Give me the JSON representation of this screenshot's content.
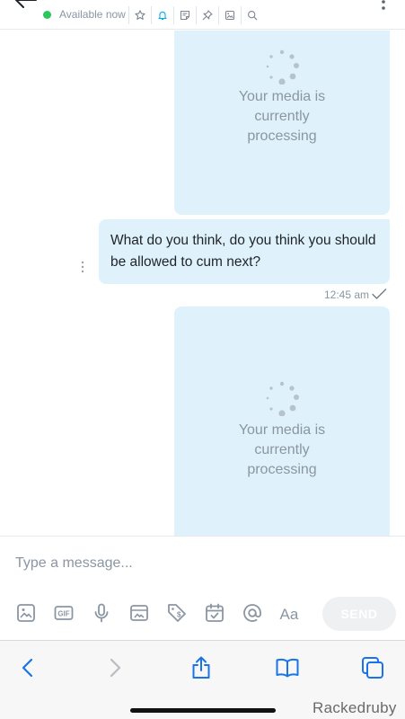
{
  "header": {
    "status": "Available now",
    "status_color": "#2bc65c",
    "icons": [
      "star-icon",
      "bell-icon",
      "note-icon",
      "pin-icon",
      "image-gallery-icon",
      "search-icon"
    ]
  },
  "messages": [
    {
      "type": "media",
      "text": "Your media is\ncurrently\nprocessing"
    },
    {
      "type": "text",
      "text": "What do you think, do you think you should be allowed to cum next?",
      "time": "12:45 am"
    },
    {
      "type": "media",
      "text": "Your media is\ncurrently\nprocessing"
    }
  ],
  "composer": {
    "placeholder": "Type a message...",
    "tools": [
      "image-icon",
      "gif-icon",
      "microphone-icon",
      "media-vault-icon",
      "price-tag-icon",
      "schedule-icon",
      "mention-icon",
      "text-format-icon"
    ],
    "send_label": "SEND"
  },
  "browser": {
    "buttons": [
      "back-icon",
      "forward-icon",
      "share-icon",
      "bookmarks-icon",
      "tabs-icon"
    ]
  },
  "watermark": "Rackedruby",
  "colors": {
    "accent": "#00aff0",
    "bubble": "#dff2fb",
    "muted_text": "#8a96a3",
    "browser_blue": "#1a73e8"
  }
}
